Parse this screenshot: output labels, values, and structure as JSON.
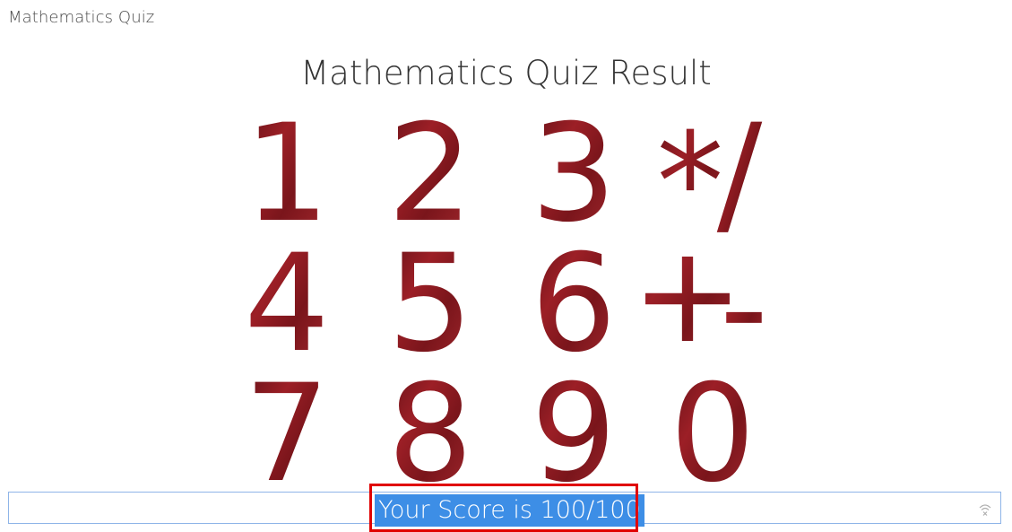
{
  "window": {
    "app_title": "Mathematics Quiz"
  },
  "main": {
    "heading": "Mathematics Quiz Result",
    "digit_art": {
      "rows": [
        [
          "1",
          "2",
          "3",
          "*/"
        ],
        [
          "4",
          "5",
          "6",
          "+-"
        ],
        [
          "7",
          "8",
          "9",
          "0"
        ]
      ],
      "color": "#8b1a1f"
    },
    "score": {
      "text": "Your Score is 100/100",
      "selection_color": "#3d8ee6",
      "highlight_border_color": "#e00000"
    },
    "icons": {
      "clear": "clear-icon"
    }
  }
}
